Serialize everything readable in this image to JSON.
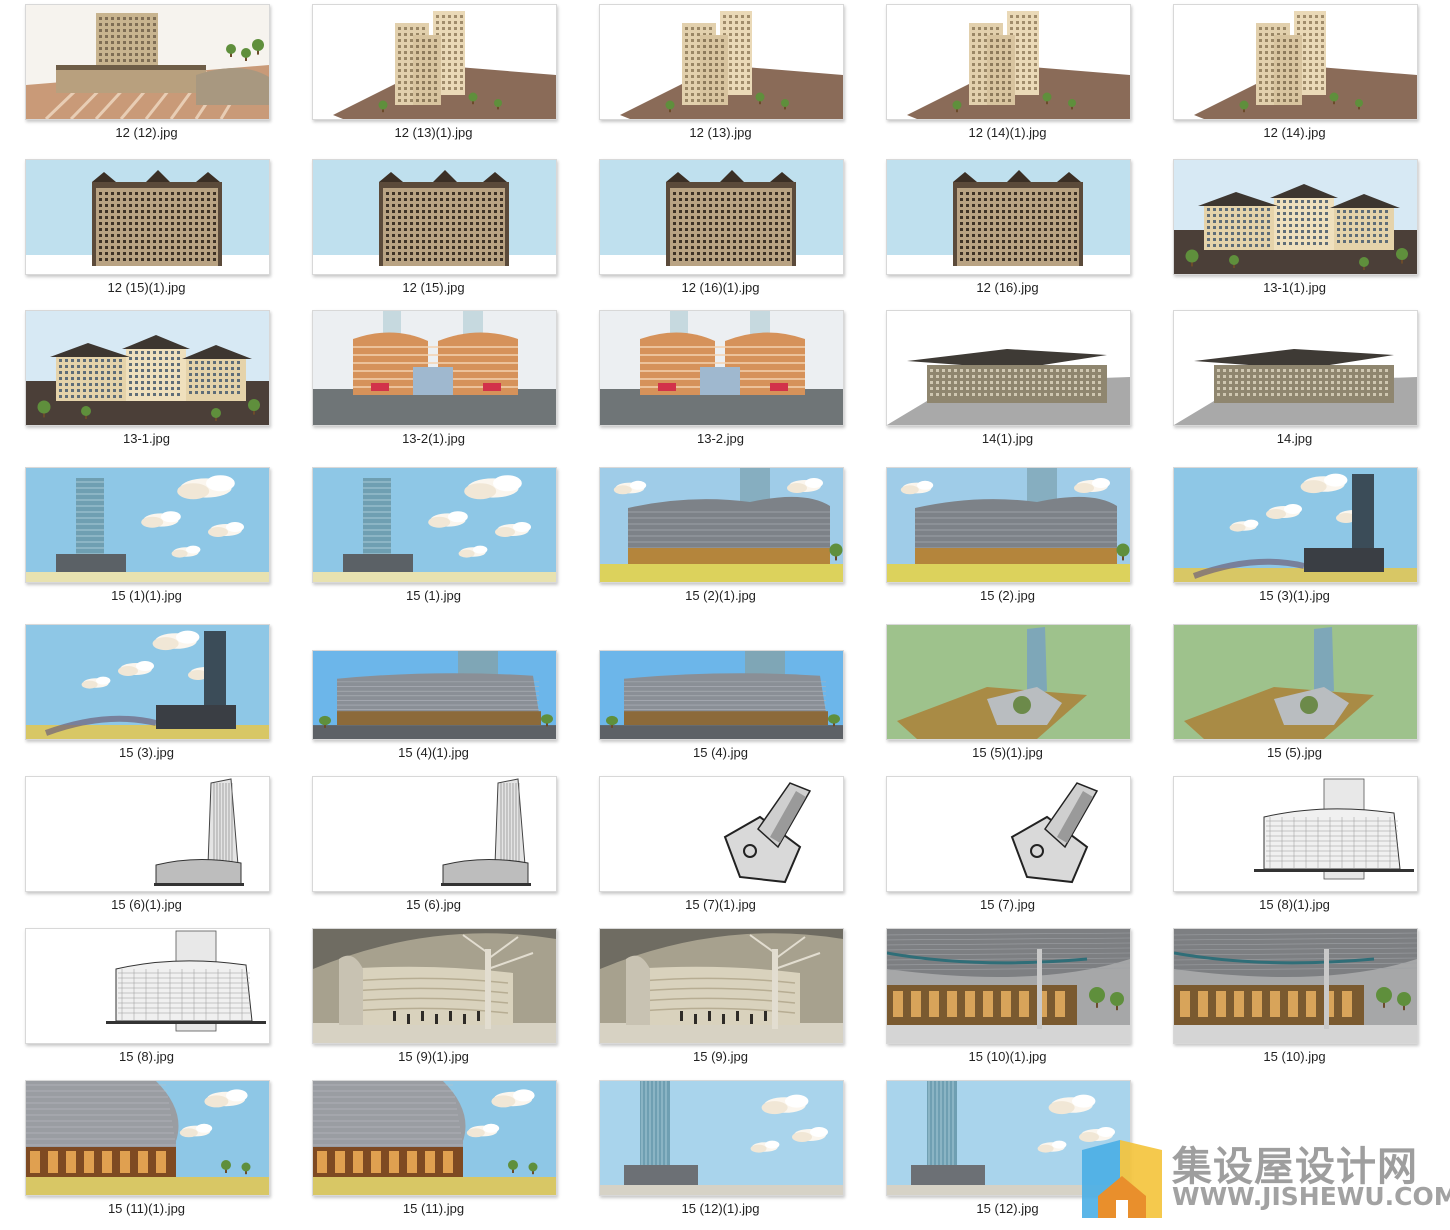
{
  "gallery": {
    "items": [
      {
        "caption": "12 (12).jpg",
        "scene": "podium"
      },
      {
        "caption": "12 (13)(1).jpg",
        "scene": "towers-site"
      },
      {
        "caption": "12 (13).jpg",
        "scene": "towers-site"
      },
      {
        "caption": "12 (14)(1).jpg",
        "scene": "towers-site"
      },
      {
        "caption": "12 (14).jpg",
        "scene": "towers-site"
      },
      {
        "caption": "12 (15)(1).jpg",
        "scene": "slab-sky"
      },
      {
        "caption": "12 (15).jpg",
        "scene": "slab-sky"
      },
      {
        "caption": "12 (16)(1).jpg",
        "scene": "slab-sky"
      },
      {
        "caption": "12 (16).jpg",
        "scene": "slab-sky"
      },
      {
        "caption": "13-1(1).jpg",
        "scene": "villa"
      },
      {
        "caption": "13-1.jpg",
        "scene": "villa"
      },
      {
        "caption": "13-2(1).jpg",
        "scene": "mall-orange"
      },
      {
        "caption": "13-2.jpg",
        "scene": "mall-orange"
      },
      {
        "caption": "14(1).jpg",
        "scene": "lowrise"
      },
      {
        "caption": "14.jpg",
        "scene": "lowrise"
      },
      {
        "caption": "15 (1)(1).jpg",
        "scene": "glass-tower-cloud"
      },
      {
        "caption": "15 (1).jpg",
        "scene": "glass-tower-cloud"
      },
      {
        "caption": "15 (2)(1).jpg",
        "scene": "mall-curve-cloud"
      },
      {
        "caption": "15 (2).jpg",
        "scene": "mall-curve-cloud"
      },
      {
        "caption": "15 (3)(1).jpg",
        "scene": "tower-right-cloud"
      },
      {
        "caption": "15 (3).jpg",
        "scene": "tower-right-cloud"
      },
      {
        "caption": "15 (4)(1).jpg",
        "scene": "mall-blue"
      },
      {
        "caption": "15 (4).jpg",
        "scene": "mall-blue"
      },
      {
        "caption": "15 (5)(1).jpg",
        "scene": "green-site"
      },
      {
        "caption": "15 (5).jpg",
        "scene": "green-site"
      },
      {
        "caption": "15 (6)(1).jpg",
        "scene": "sketch-tower"
      },
      {
        "caption": "15 (6).jpg",
        "scene": "sketch-tower"
      },
      {
        "caption": "15 (7)(1).jpg",
        "scene": "sketch-plan"
      },
      {
        "caption": "15 (7).jpg",
        "scene": "sketch-plan"
      },
      {
        "caption": "15 (8)(1).jpg",
        "scene": "sketch-mall"
      },
      {
        "caption": "15 (8).jpg",
        "scene": "sketch-mall"
      },
      {
        "caption": "15 (9)(1).jpg",
        "scene": "beige-interior"
      },
      {
        "caption": "15 (9).jpg",
        "scene": "beige-interior"
      },
      {
        "caption": "15 (10)(1).jpg",
        "scene": "grey-street"
      },
      {
        "caption": "15 (10).jpg",
        "scene": "grey-street"
      },
      {
        "caption": "15 (11)(1).jpg",
        "scene": "mall-close-cloud"
      },
      {
        "caption": "15 (11).jpg",
        "scene": "mall-close-cloud"
      },
      {
        "caption": "15 (12)(1).jpg",
        "scene": "glass-tower-center"
      },
      {
        "caption": "15 (12).jpg",
        "scene": "glass-tower-center"
      }
    ]
  },
  "watermark": {
    "name_cn": "集设屋设计网",
    "url": "WWW.JISHEWU.COM",
    "colors": {
      "text": "#9e9e9e",
      "logo_blue": "#49aee6",
      "logo_yellow": "#f4c33a",
      "logo_orange": "#e98f2c"
    }
  }
}
